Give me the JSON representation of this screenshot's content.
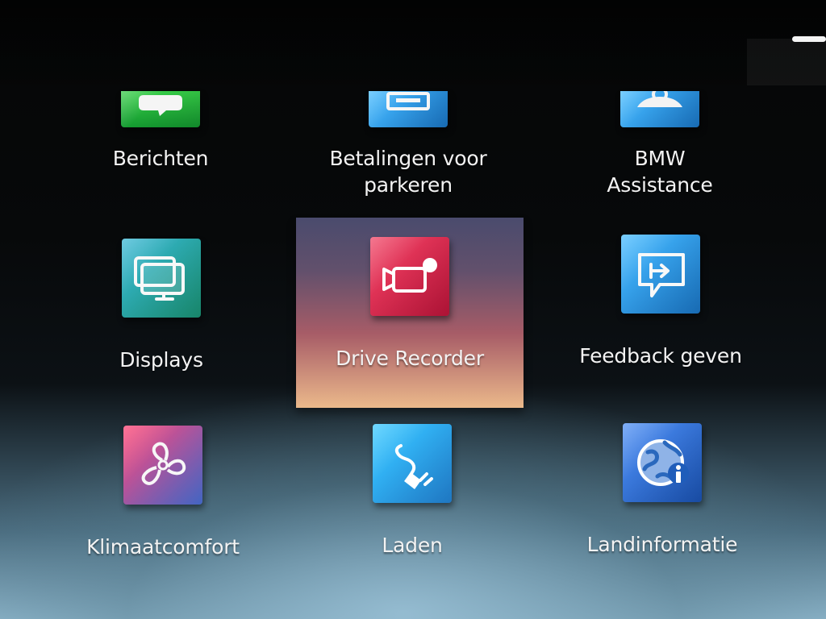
{
  "screen": {
    "accent_color": "#e9244a",
    "scroll_indicator_color": "#f4f4f4"
  },
  "apps": [
    {
      "label": "Berichten",
      "icon": "message-bubble-icon",
      "color": "#21b83c"
    },
    {
      "label": "Betalingen voor\nparkeren",
      "icon": "parking-payment-icon",
      "color": "#2c9be8"
    },
    {
      "label": "BMW\nAssistance",
      "icon": "assistance-person-icon",
      "color": "#2f93e8"
    },
    {
      "label": "Displays",
      "icon": "displays-icon",
      "color": "#23a6aa"
    },
    {
      "label": "Drive Recorder",
      "icon": "video-recorder-icon",
      "color": "#df2953",
      "selected": true
    },
    {
      "label": "Feedback geven",
      "icon": "feedback-speech-icon",
      "color": "#2c9be8"
    },
    {
      "label": "Klimaatcomfort",
      "icon": "fan-icon",
      "color": "#c855a3"
    },
    {
      "label": "Laden",
      "icon": "charging-plug-icon",
      "color": "#2ba8ee"
    },
    {
      "label": "Landinformatie",
      "icon": "country-info-globe-icon",
      "color": "#3f79df"
    }
  ]
}
